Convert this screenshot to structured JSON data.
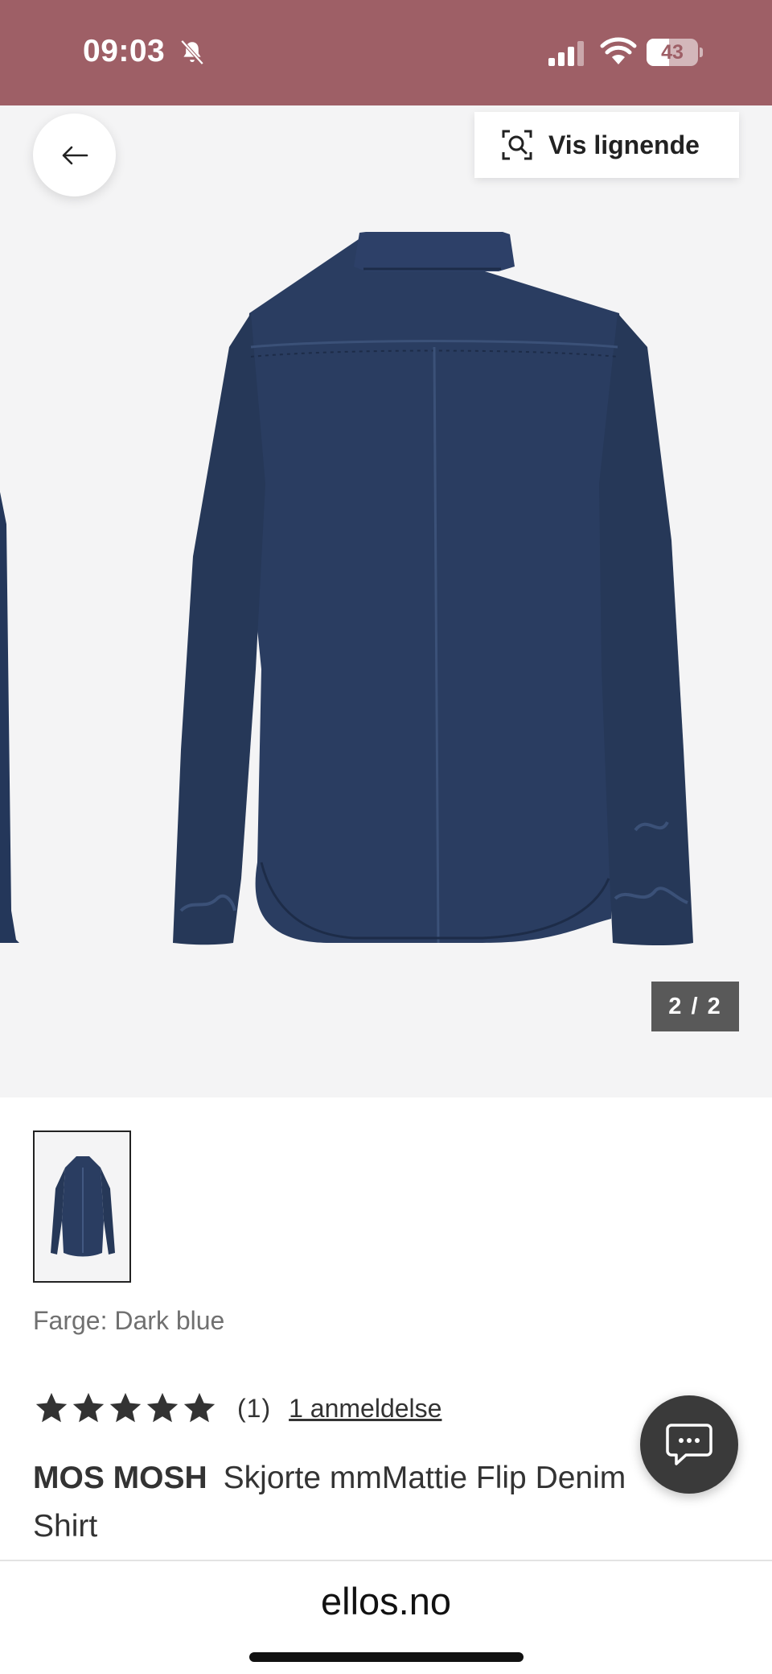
{
  "status_bar": {
    "time": "09:03",
    "battery": "43",
    "battery_level": 0.43,
    "background_color": "#9e5f66",
    "icons": [
      "bell-slash-icon",
      "cellular-signal-icon",
      "wifi-icon",
      "battery-icon"
    ]
  },
  "gallery": {
    "back_icon": "arrow-left-icon",
    "similar_icon": "visual-search-icon",
    "similar_label": "Vis lignende",
    "page_counter": "2 / 2"
  },
  "product": {
    "color_label": "Farge: Dark blue",
    "rating": {
      "stars": 5,
      "count": "(1)",
      "reviews_link": "1 anmeldelse"
    },
    "brand": "MOS MOSH",
    "name": "Skjorte mmMattie Flip Denim Shirt",
    "denim_color": "#2a3d61"
  },
  "chat": {
    "icon": "chat-bubble-icon"
  },
  "browser": {
    "url": "ellos.no"
  }
}
